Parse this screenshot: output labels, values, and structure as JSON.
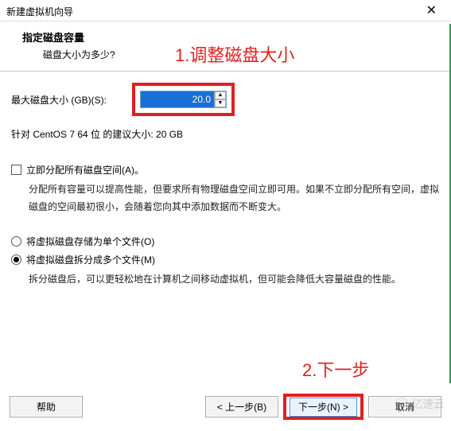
{
  "window": {
    "title": "新建虚拟机向导",
    "close_icon": "✕"
  },
  "header": {
    "title": "指定磁盘容量",
    "subtitle": "磁盘大小为多少?"
  },
  "annotations": {
    "step1": "1.调整磁盘大小",
    "step2": "2.下一步"
  },
  "disk": {
    "label": "最大磁盘大小 (GB)(S):",
    "value": "20.0",
    "recommendation": "针对 CentOS 7 64 位 的建议大小: 20 GB"
  },
  "allocate": {
    "checkbox_label": "立即分配所有磁盘空间(A)。",
    "description": "分配所有容量可以提高性能，但要求所有物理磁盘空间立即可用。如果不立即分配所有空间，虚拟磁盘的空间最初很小，会随着您向其中添加数据而不断变大。"
  },
  "storage": {
    "single_label": "将虚拟磁盘存储为单个文件(O)",
    "split_label": "将虚拟磁盘拆分成多个文件(M)",
    "split_desc": "拆分磁盘后，可以更轻松地在计算机之间移动虚拟机，但可能会降低大容量磁盘的性能。"
  },
  "footer": {
    "help": "帮助",
    "back": "< 上一步(B)",
    "next": "下一步(N) >",
    "cancel": "取消"
  },
  "watermark": {
    "text": "亿速云"
  }
}
